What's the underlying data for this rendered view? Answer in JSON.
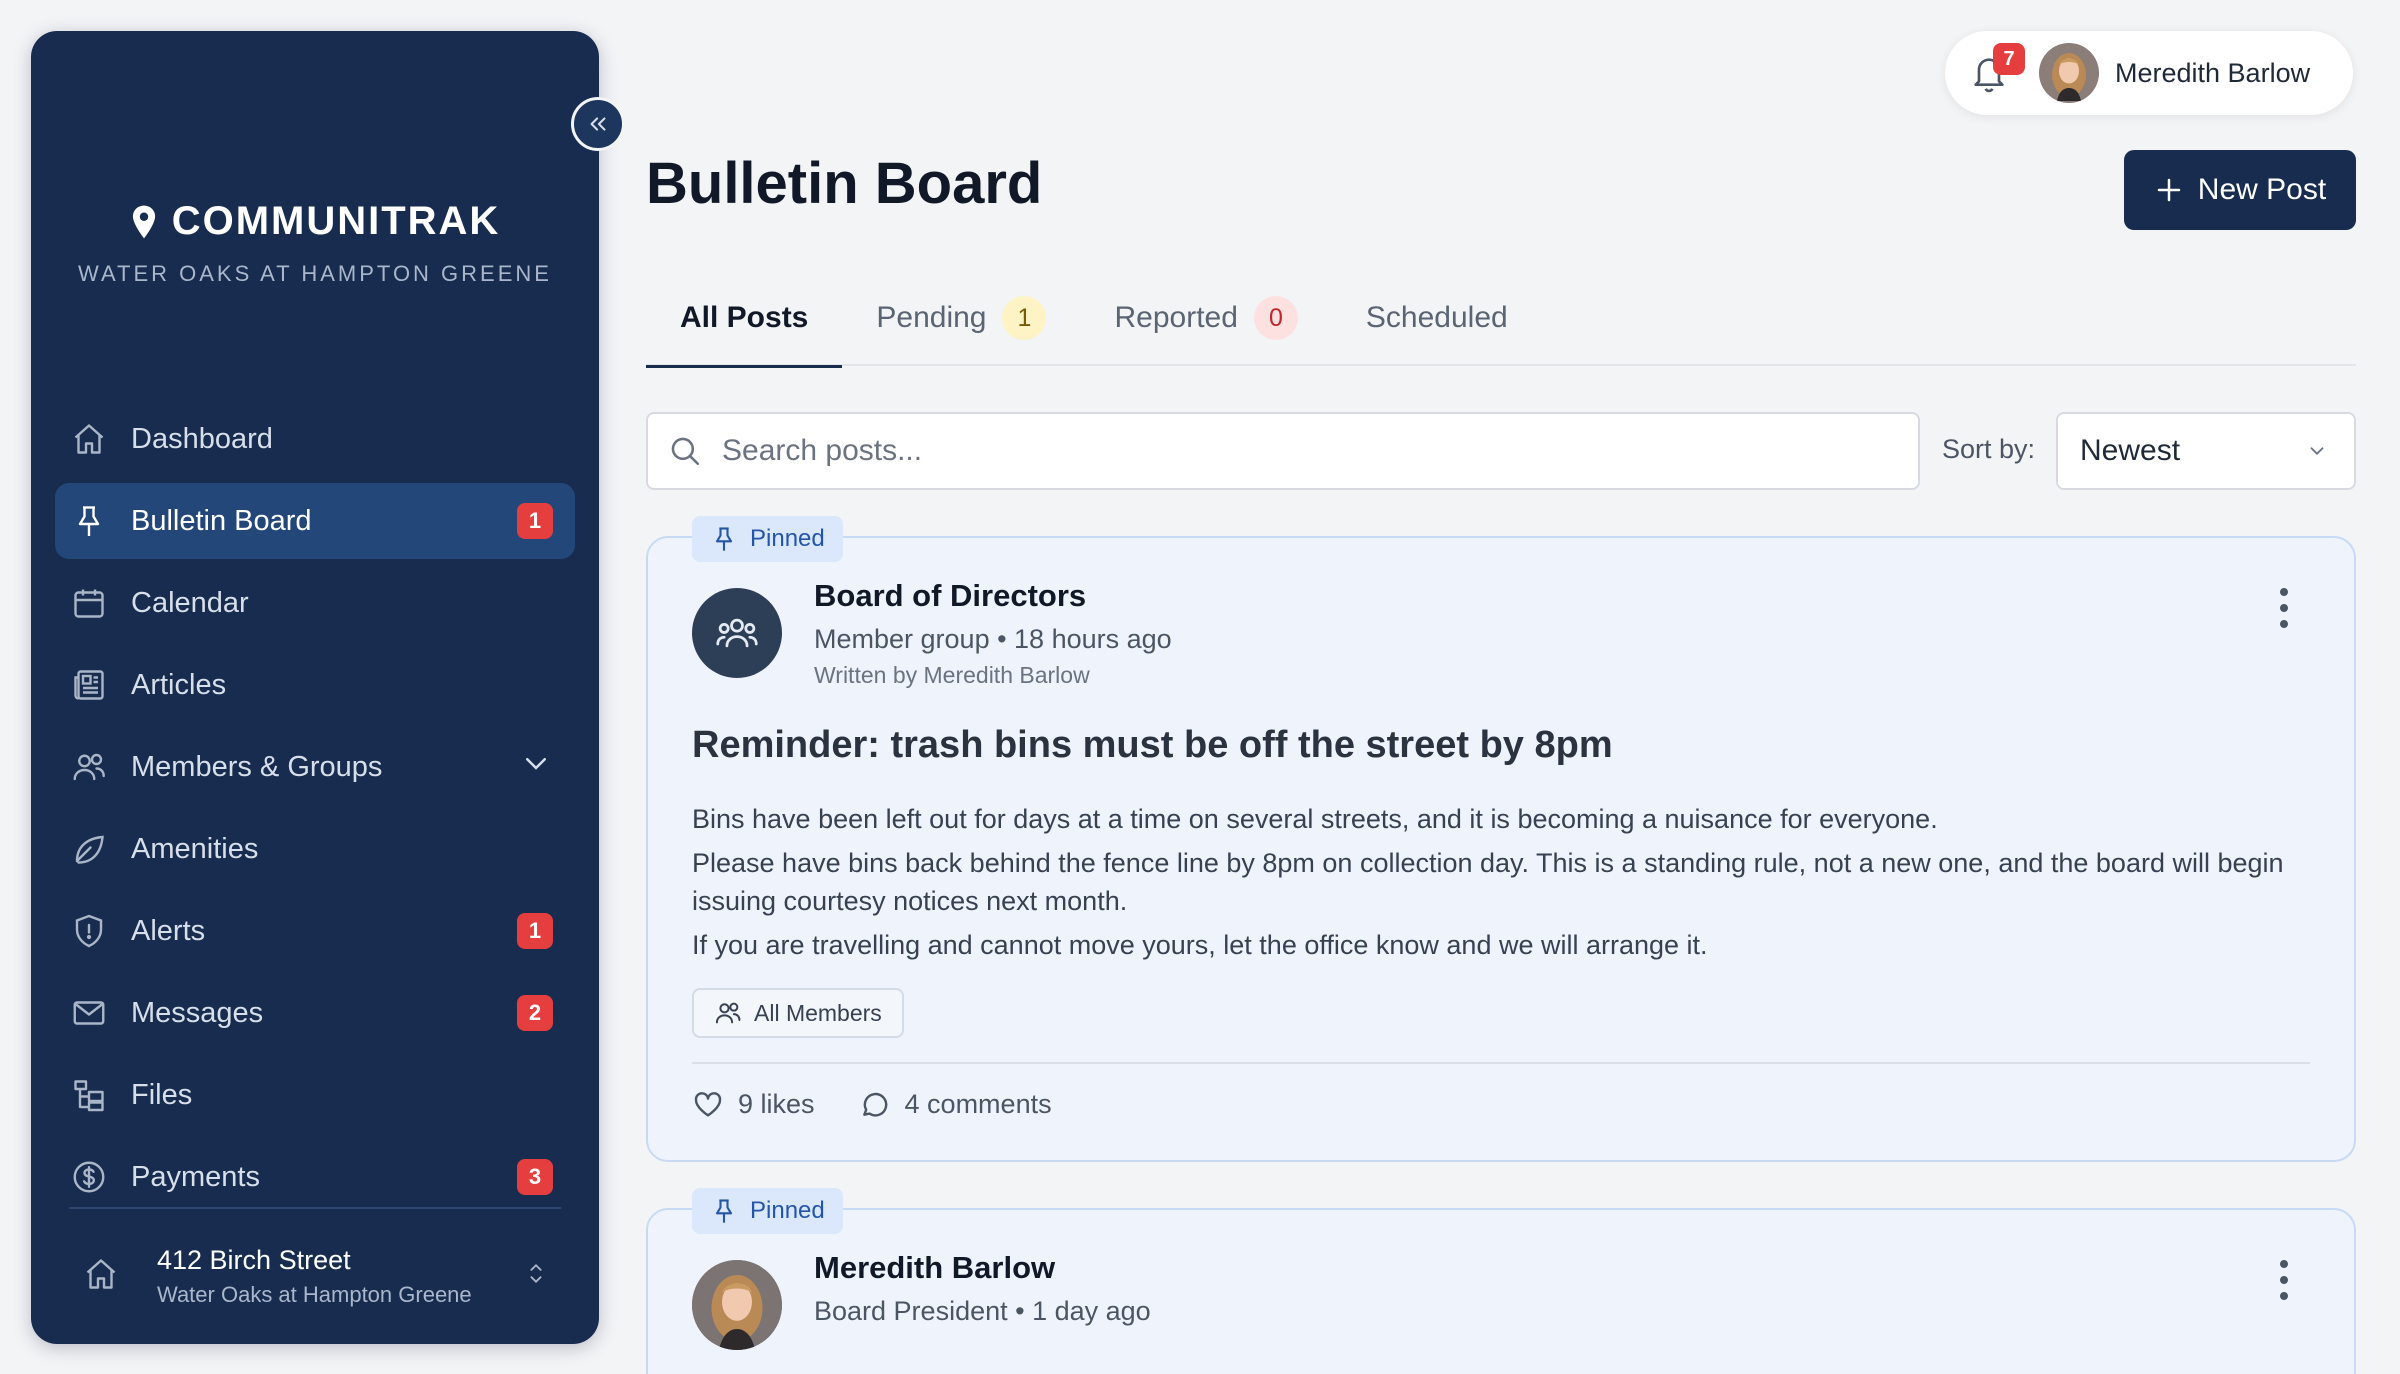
{
  "sidebar": {
    "brand": {
      "name": "COMMUNITRAK",
      "subtitle": "WATER OAKS AT HAMPTON GREENE"
    },
    "items": [
      {
        "label": "Dashboard",
        "icon": "home-icon"
      },
      {
        "label": "Bulletin Board",
        "icon": "pin-icon",
        "badge": "1",
        "active": true
      },
      {
        "label": "Calendar",
        "icon": "calendar-icon"
      },
      {
        "label": "Articles",
        "icon": "newspaper-icon"
      },
      {
        "label": "Members & Groups",
        "icon": "users-icon",
        "expandable": true
      },
      {
        "label": "Amenities",
        "icon": "leaf-icon"
      },
      {
        "label": "Alerts",
        "icon": "shield-icon",
        "badge": "1"
      },
      {
        "label": "Messages",
        "icon": "mail-icon",
        "badge": "2"
      },
      {
        "label": "Files",
        "icon": "folder-tree-icon"
      },
      {
        "label": "Payments",
        "icon": "dollar-icon",
        "badge": "3"
      }
    ],
    "property": {
      "address": "412 Birch Street",
      "community": "Water Oaks at Hampton Greene"
    }
  },
  "topbar": {
    "notifications": "7",
    "user_name": "Meredith Barlow"
  },
  "header": {
    "title": "Bulletin Board",
    "new_post_label": "New Post"
  },
  "tabs": [
    {
      "label": "All Posts",
      "active": true
    },
    {
      "label": "Pending",
      "count": "1"
    },
    {
      "label": "Reported",
      "count": "0"
    },
    {
      "label": "Scheduled"
    }
  ],
  "search": {
    "placeholder": "Search posts..."
  },
  "sort": {
    "label": "Sort by:",
    "value": "Newest"
  },
  "posts": [
    {
      "pinned_label": "Pinned",
      "author": "Board of Directors",
      "meta": "Member group • 18 hours ago",
      "written_by": "Written by Meredith Barlow",
      "title": "Reminder: trash bins must be off the street by 8pm",
      "body": [
        "Bins have been left out for days at a time on several streets, and it is becoming a nuisance for everyone.",
        "Please have bins back behind the fence line by 8pm on collection day. This is a standing rule, not a new one, and the board will begin issuing courtesy notices next month.",
        "If you are travelling and cannot move yours, let the office know and we will arrange it."
      ],
      "audience": "All Members",
      "likes": "9 likes",
      "comments": "4 comments"
    },
    {
      "pinned_label": "Pinned",
      "author": "Meredith Barlow",
      "meta": "Board President • 1 day ago"
    }
  ],
  "colors": {
    "sidebar": "#172c4e",
    "accent_active": "#24477a",
    "badge": "#e53e3e",
    "pinned": "#2456a8"
  }
}
